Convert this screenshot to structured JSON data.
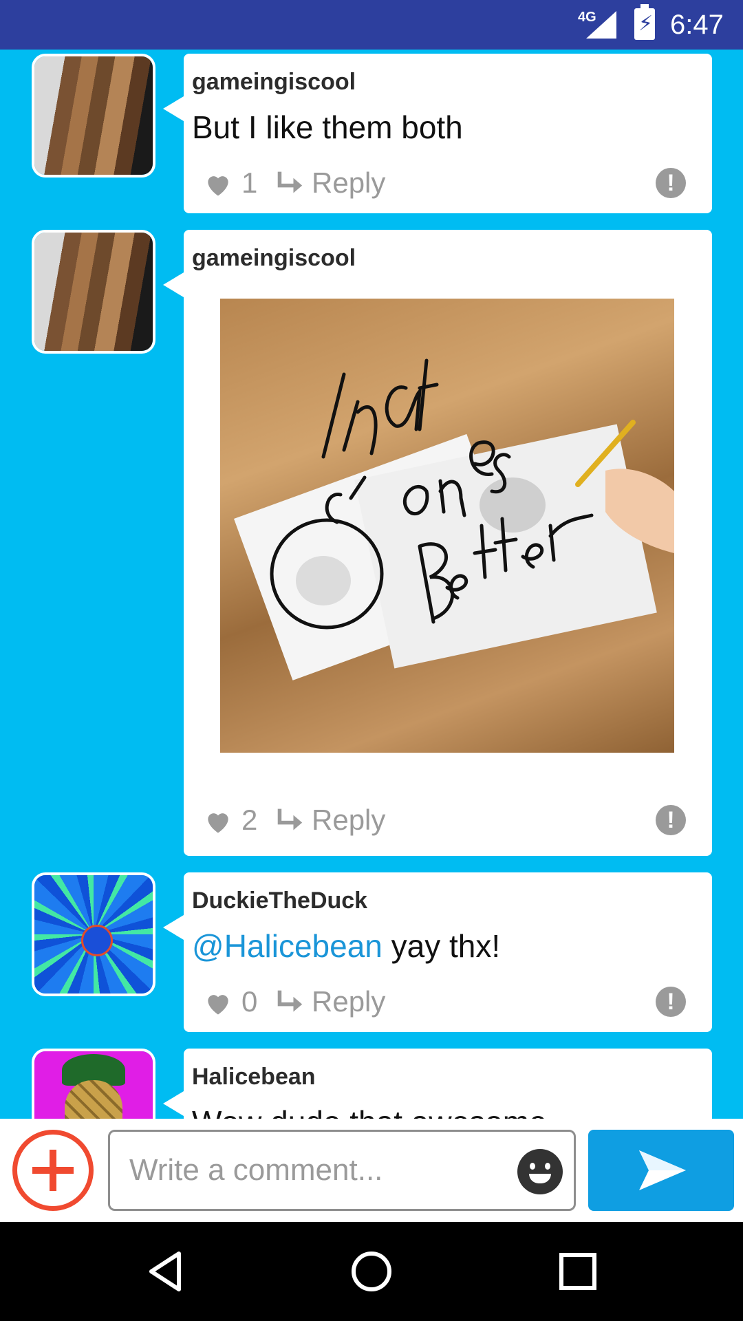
{
  "status_bar": {
    "network": "4G",
    "time": "6:47",
    "icons": [
      "signal-icon",
      "battery-charging-icon"
    ]
  },
  "comments": [
    {
      "username": "gameingiscool",
      "text": "But I like them both",
      "likes": "1",
      "reply_label": "Reply",
      "avatar": "long-hair-photo"
    },
    {
      "username": "gameingiscool",
      "image": {
        "depicts": "two cat pencil drawings on paper on a wooden table",
        "handwriting": [
          "that",
          "ones",
          "Better"
        ]
      },
      "likes": "2",
      "reply_label": "Reply",
      "avatar": "long-hair-photo"
    },
    {
      "username": "DuckieTheDuck",
      "mention": "@Halicebean",
      "text": " yay thx!",
      "likes": "0",
      "reply_label": "Reply",
      "avatar": "blue-swirl-duck"
    },
    {
      "username": "Halicebean",
      "text": "Wow dude that awesome",
      "avatar": "pineapple-magenta"
    }
  ],
  "composer": {
    "placeholder": "Write a comment...",
    "icons": [
      "add-icon",
      "emoji-icon",
      "send-icon"
    ]
  },
  "nav": {
    "icons": [
      "back-icon",
      "home-icon",
      "recents-icon"
    ]
  },
  "colors": {
    "background": "#00bcf2",
    "status_bar": "#2d3f9e",
    "accent_red": "#f04a30",
    "send_blue": "#0f9ee2",
    "mention": "#1a95d8"
  }
}
